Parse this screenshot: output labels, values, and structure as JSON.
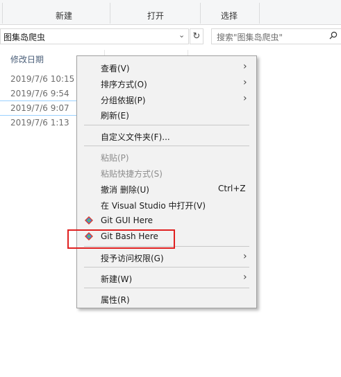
{
  "ribbon": {
    "groups": [
      "新建",
      "打开",
      "选择"
    ]
  },
  "address": {
    "path": "图集岛爬虫",
    "search_placeholder": "搜索\"图集岛爬虫\""
  },
  "list": {
    "column_header": "修改日期",
    "rows": [
      "2019/7/6 10:15",
      "2019/7/6 9:54",
      "2019/7/6 9:07",
      "2019/7/6 1:13"
    ]
  },
  "menu": {
    "items": [
      {
        "label": "查看(V)",
        "submenu": true
      },
      {
        "label": "排序方式(O)",
        "submenu": true
      },
      {
        "label": "分组依据(P)",
        "submenu": true
      },
      {
        "label": "刷新(E)"
      },
      {
        "label": "自定义文件夹(F)..."
      },
      {
        "label": "粘贴(P)",
        "disabled": true
      },
      {
        "label": "粘贴快捷方式(S)",
        "disabled": true
      },
      {
        "label": "撤消 删除(U)",
        "shortcut": "Ctrl+Z"
      },
      {
        "label": "在 Visual Studio 中打开(V)"
      },
      {
        "label": "Git GUI Here",
        "icon": "git-icon"
      },
      {
        "label": "Git Bash Here",
        "icon": "git-icon"
      },
      {
        "label": "授予访问权限(G)",
        "submenu": true
      },
      {
        "label": "新建(W)",
        "submenu": true
      },
      {
        "label": "属性(R)"
      }
    ]
  },
  "colors": {
    "highlight_box": "#e02020",
    "menu_bg": "#f2f2f2",
    "selection_border": "#99d1ff"
  }
}
